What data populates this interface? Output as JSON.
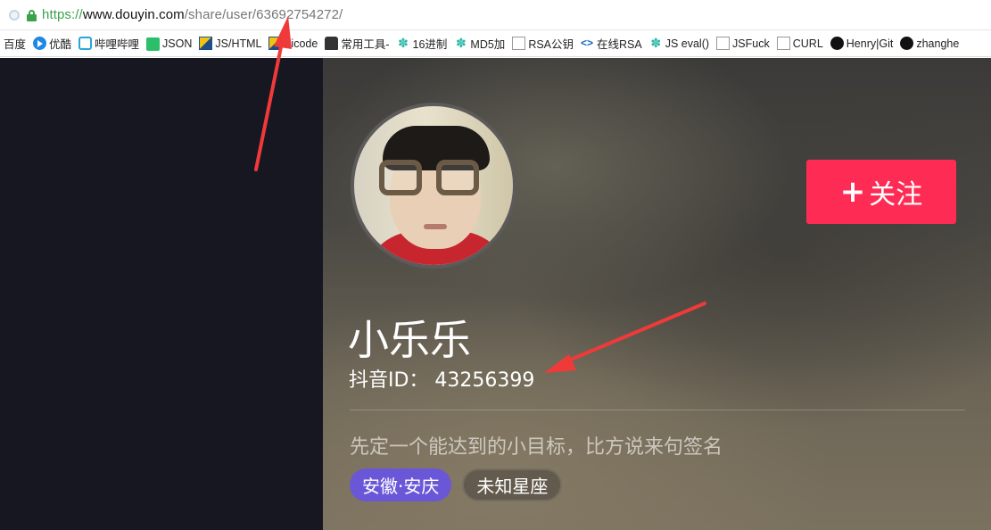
{
  "browser": {
    "url_scheme": "https://",
    "url_host": "www.douyin.com",
    "url_path": "/share/user/63692754272/"
  },
  "bookmarks": [
    {
      "label": "百度",
      "icon": "none"
    },
    {
      "label": "优酷",
      "icon": "youku-icon"
    },
    {
      "label": "哔哩哔哩",
      "icon": "bilibili-icon"
    },
    {
      "label": "JSON",
      "icon": "json-icon"
    },
    {
      "label": "JS/HTML",
      "icon": "jshtml-icon"
    },
    {
      "label": "nicode",
      "icon": "jshtml-icon"
    },
    {
      "label": "常用工具-",
      "icon": "robot-icon"
    },
    {
      "label": "16进制",
      "icon": "gear-icon"
    },
    {
      "label": "MD5加",
      "icon": "gear-icon"
    },
    {
      "label": "RSA公钥",
      "icon": "page-icon"
    },
    {
      "label": "在线RSA",
      "icon": "code-icon"
    },
    {
      "label": "JS eval()",
      "icon": "gear-icon"
    },
    {
      "label": "JSFuck",
      "icon": "page-icon"
    },
    {
      "label": "CURL",
      "icon": "page-icon"
    },
    {
      "label": "Henry|Git",
      "icon": "github-icon"
    },
    {
      "label": "zhanghe",
      "icon": "github-icon"
    }
  ],
  "profile": {
    "nickname": "小乐乐",
    "douyin_id": "抖音ID： 43256399",
    "signature": "先定一个能达到的小目标，比方说来句签名",
    "tags": [
      "安徽·安庆",
      "未知星座"
    ],
    "follow_label": "关注",
    "follow_plus": "+"
  },
  "colors": {
    "follow_button": "#fe2c55",
    "location_tag": "#6a57d8",
    "annotation_arrow": "#f03a3a",
    "dark_panel": "#161721"
  }
}
